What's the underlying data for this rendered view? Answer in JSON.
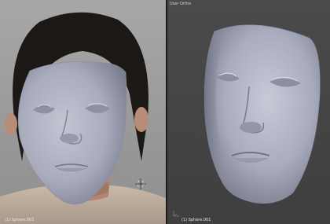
{
  "viewports": {
    "left": {
      "object_label": "(1) Sphere.001",
      "cursor_icon": "3d-cursor-icon",
      "background_image": "photo-of-woman-with-face-mesh-overlay"
    },
    "right": {
      "header_label": "User Ortho",
      "object_label": "(1) Sphere.001",
      "axis_icon": "axis-gizmo-icon"
    }
  },
  "colors": {
    "mesh": "#a9acbd",
    "hair": "#1b1816",
    "skin": "#b48a74",
    "viewport_bg": "#444444"
  }
}
